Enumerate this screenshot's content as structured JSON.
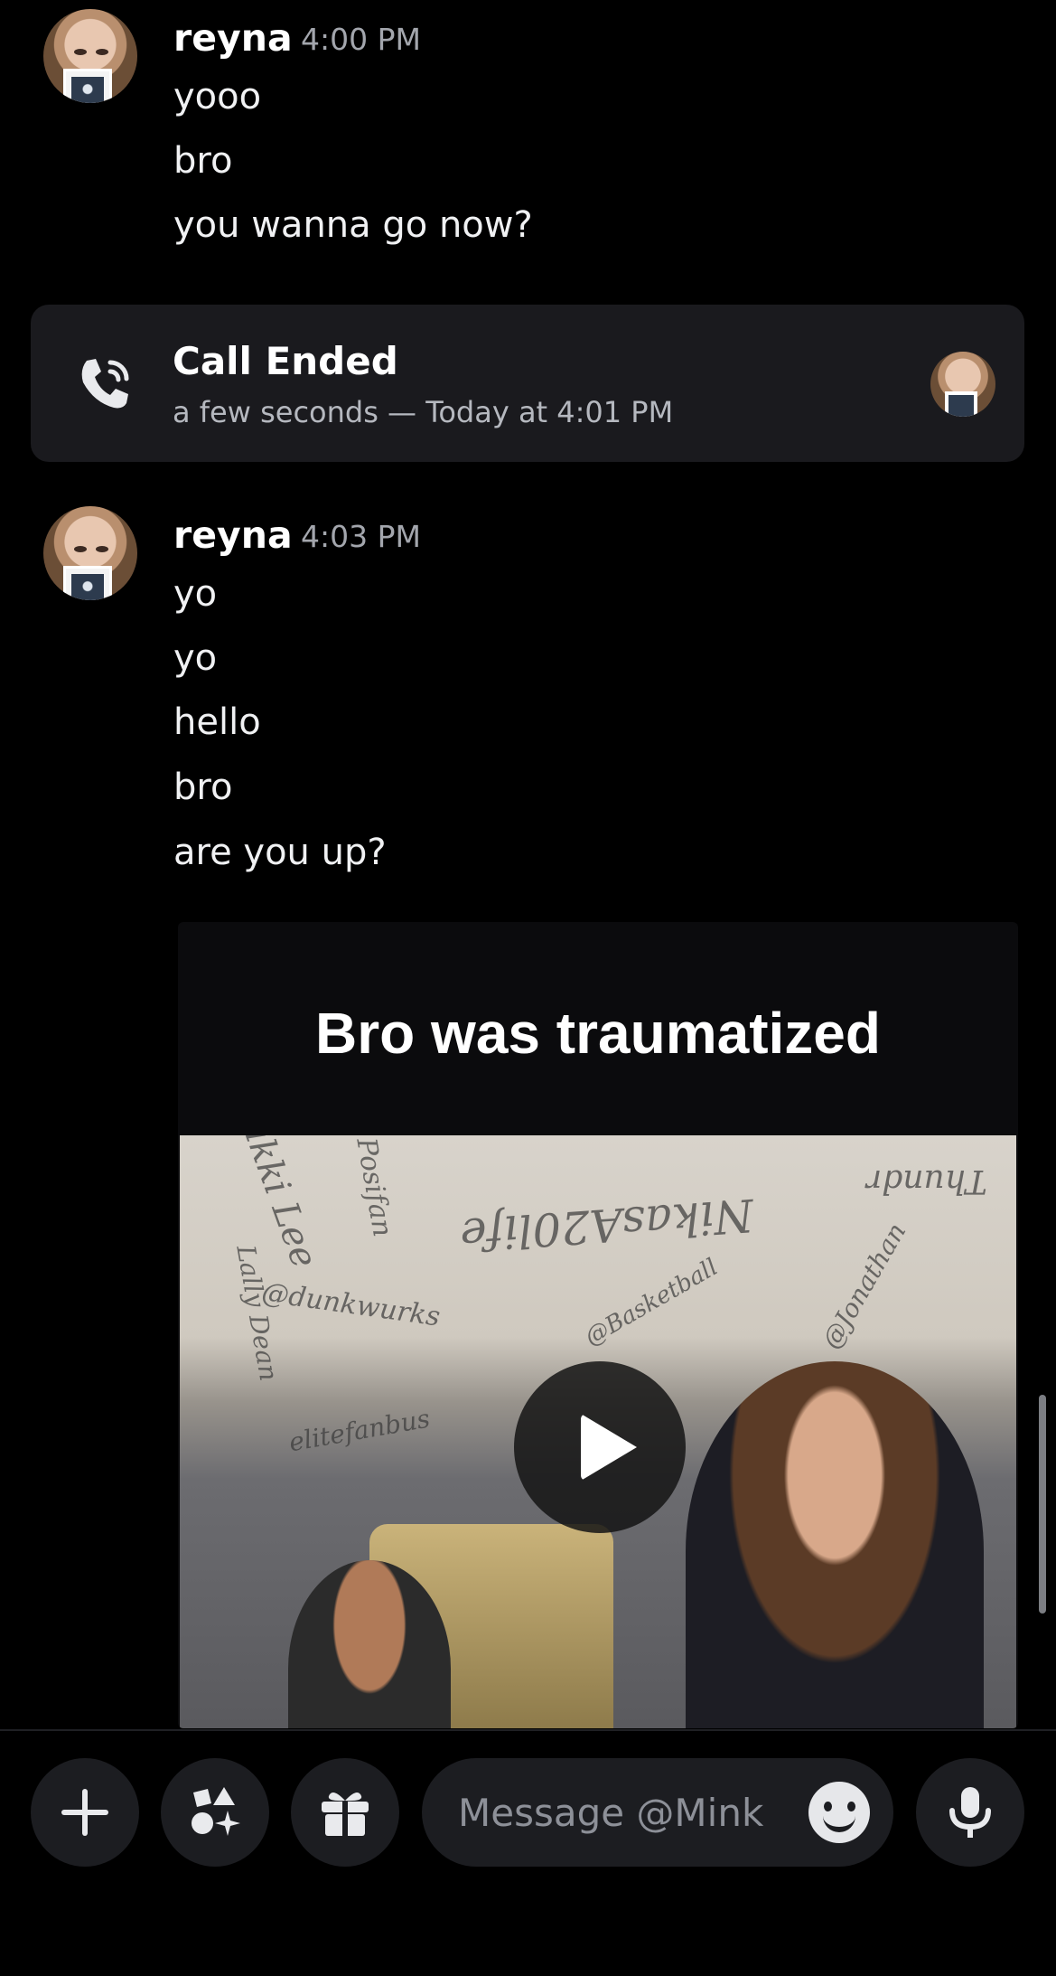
{
  "messages": [
    {
      "author": "reyna",
      "time": "4:00 PM",
      "lines": [
        "yooo",
        "bro",
        "you wanna go now?"
      ]
    },
    {
      "author": "reyna",
      "time": "4:03 PM",
      "lines": [
        "yo",
        "yo",
        "hello",
        "bro",
        "are you up?"
      ]
    }
  ],
  "call": {
    "title": "Call Ended",
    "subtitle": "a few seconds — Today at 4:01 PM"
  },
  "video": {
    "caption": "Bro was traumatized",
    "scribbles": [
      "Nikki Lee",
      "@dunkwurks",
      "NikasA20life",
      "Posifan",
      "@Basketball",
      "elitefanbus",
      "@Jonathan",
      "Lally Dean",
      "Thundr"
    ]
  },
  "composer": {
    "placeholder": "Message @Mink",
    "icons": [
      "plus-icon",
      "apps-icon",
      "gift-icon",
      "emoji-icon",
      "microphone-icon"
    ]
  },
  "colors": {
    "background": "#000000",
    "card": "#1a1a1e",
    "muted_text": "#a3a6ad",
    "button": "#1c1d21"
  }
}
